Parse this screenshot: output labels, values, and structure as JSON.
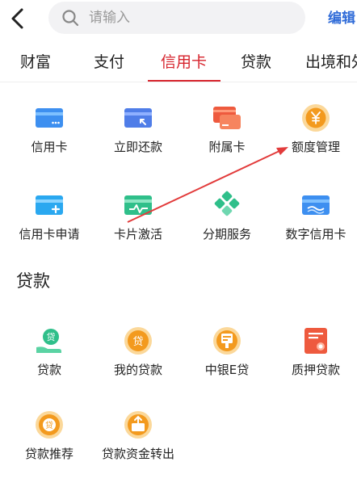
{
  "header": {
    "search_placeholder": "请输入",
    "edit_label": "编辑"
  },
  "tabs": [
    {
      "label": "财富"
    },
    {
      "label": "支付"
    },
    {
      "label": "信用卡"
    },
    {
      "label": "贷款"
    },
    {
      "label": "出境和外"
    }
  ],
  "credit_card": {
    "items": [
      {
        "label": "信用卡",
        "icon": "card-icon"
      },
      {
        "label": "立即还款",
        "icon": "card-repay-icon"
      },
      {
        "label": "附属卡",
        "icon": "supplementary-card-icon"
      },
      {
        "label": "额度管理",
        "icon": "yen-coin-icon"
      },
      {
        "label": "信用卡申请",
        "icon": "card-apply-icon"
      },
      {
        "label": "卡片激活",
        "icon": "card-activate-icon"
      },
      {
        "label": "分期服务",
        "icon": "installment-icon"
      },
      {
        "label": "数字信用卡",
        "icon": "digital-card-icon"
      }
    ]
  },
  "loans": {
    "title": "贷款",
    "items": [
      {
        "label": "贷款",
        "icon": "loan-hand-icon"
      },
      {
        "label": "我的贷款",
        "icon": "loan-coin-icon"
      },
      {
        "label": "中银E贷",
        "icon": "e-loan-icon"
      },
      {
        "label": "质押贷款",
        "icon": "pledge-loan-icon"
      },
      {
        "label": "贷款推荐",
        "icon": "loan-recommend-icon"
      },
      {
        "label": "贷款资金转出",
        "icon": "loan-transfer-icon"
      }
    ]
  },
  "colors": {
    "accent": "#d6232c",
    "link": "#2f6bd8",
    "blue": "#3d8ff0",
    "green": "#2fbf8a",
    "orange": "#f39a1e",
    "red": "#ee5a3e"
  }
}
